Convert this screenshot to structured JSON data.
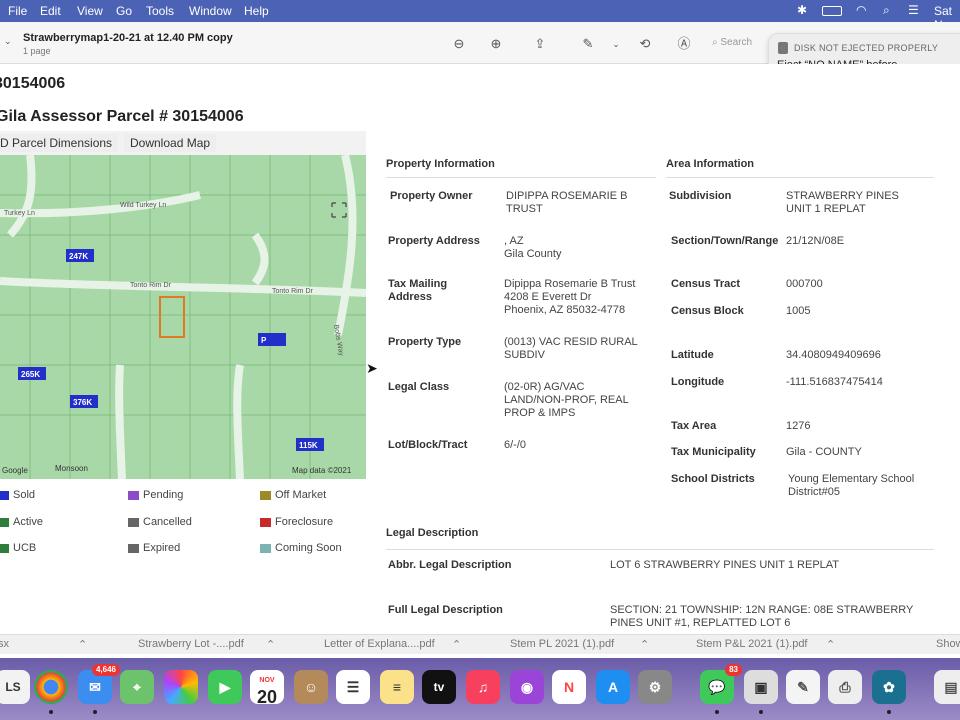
{
  "menubar": {
    "items": [
      "File",
      "Edit",
      "View",
      "Go",
      "Tools",
      "Window",
      "Help"
    ],
    "clock": "Sat N"
  },
  "toolbar": {
    "title": "Strawberrymap1-20-21 at 12.40 PM copy",
    "subtitle": "1 page",
    "search_placeholder": "Search"
  },
  "notification": {
    "title": "DISK NOT EJECTED PROPERLY",
    "body": "Eject “NO NAME” before disconnecting or turning it off."
  },
  "doc": {
    "heading1": "30154006",
    "heading2": "Gila Assessor Parcel # 30154006",
    "map_tabs": [
      "D Parcel Dimensions",
      "Download Map"
    ],
    "map_labels": {
      "streets": [
        "Turkey Ln",
        "Wild Turkey Ln",
        "Tonto Rim Dr",
        "Tonto Rim Dr",
        "Bobs Way"
      ],
      "prices": [
        "247K",
        "P",
        "265K",
        "376K",
        "115K"
      ],
      "credits": [
        "Google",
        "Monsoon",
        "Map data ©2021"
      ]
    },
    "legend": [
      {
        "label": "Sold",
        "color": "#2230c9"
      },
      {
        "label": "Pending",
        "color": "#8a4fc7"
      },
      {
        "label": "Off Market",
        "color": "#9c8a2a"
      },
      {
        "label": "Active",
        "color": "#2f7d3a"
      },
      {
        "label": "Cancelled",
        "color": "#666666"
      },
      {
        "label": "Foreclosure",
        "color": "#c62a2a"
      },
      {
        "label": "UCB",
        "color": "#2f7d3a"
      },
      {
        "label": "Expired",
        "color": "#666666"
      },
      {
        "label": "Coming Soon",
        "color": "#7ab3b0"
      }
    ],
    "property": {
      "section_title": "Property Information",
      "rows": [
        {
          "label": "Property Owner",
          "value": "DIPIPPA ROSEMARIE B TRUST"
        },
        {
          "label": "Property Address",
          "value": ", AZ\nGila County"
        },
        {
          "label": "Tax Mailing Address",
          "value": "Dipippa Rosemarie B Trust\n4208 E Everett Dr\nPhoenix, AZ 85032-4778"
        },
        {
          "label": "Property Type",
          "value": "(0013) VAC RESID RURAL SUBDIV"
        },
        {
          "label": "Legal Class",
          "value": "(02-0R) AG/VAC LAND/NON-PROF, REAL PROP & IMPS"
        },
        {
          "label": "Lot/Block/Tract",
          "value": "6/-/0"
        }
      ]
    },
    "area": {
      "section_title": "Area Information",
      "rows": [
        {
          "label": "Subdivision",
          "value": "STRAWBERRY PINES UNIT 1 REPLAT"
        },
        {
          "label": "Section/Town/Range",
          "value": "21/12N/08E"
        },
        {
          "label": "Census Tract",
          "value": "000700"
        },
        {
          "label": "Census Block",
          "value": "1005"
        },
        {
          "label": "Latitude",
          "value": "34.4080949409696"
        },
        {
          "label": "Longitude",
          "value": "-111.516837475414"
        },
        {
          "label": "Tax Area",
          "value": "1276"
        },
        {
          "label": "Tax Municipality",
          "value": "Gila - COUNTY"
        },
        {
          "label": "School Districts",
          "value": "Young Elementary School District#05"
        }
      ]
    },
    "legal": {
      "section_title": "Legal Description",
      "rows": [
        {
          "label": "Abbr. Legal Description",
          "value": "LOT 6 STRAWBERRY PINES UNIT 1 REPLAT"
        },
        {
          "label": "Full Legal Description",
          "value": "SECTION: 21 TOWNSHIP: 12N RANGE: 08E STRAWBERRY PINES UNIT #1, REPLATTED LOT 6"
        }
      ]
    }
  },
  "downloads": [
    "sx",
    "Strawberry Lot -....pdf",
    "Letter of Explana....pdf",
    "Stem PL 2021 (1).pdf",
    "Stem P&L 2021 (1).pdf",
    "Show"
  ],
  "dock": {
    "mail_badge": "4,646",
    "calendar_month": "NOV",
    "calendar_day": "20",
    "messages_badge": "83",
    "tv_label": "tv"
  }
}
